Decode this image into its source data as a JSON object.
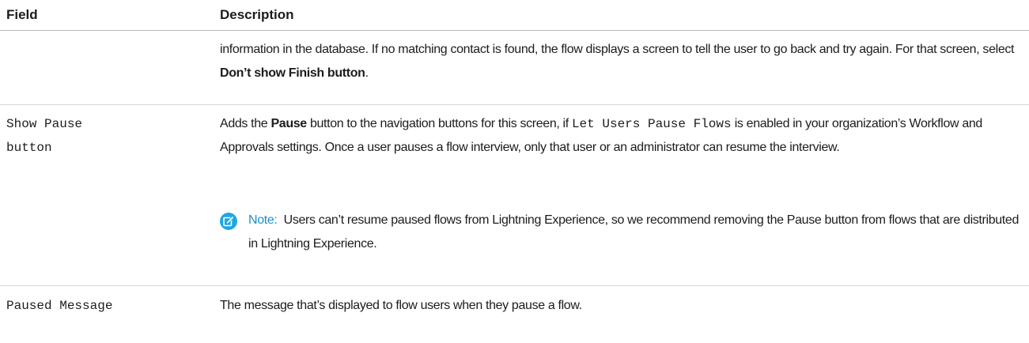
{
  "header": {
    "field": "Field",
    "description": "Description"
  },
  "rows": [
    {
      "field": "",
      "desc_before": "information in the database. If no matching contact is found, the flow displays a screen to tell the user to go back and try again. For that screen, select ",
      "desc_bold": "Don’t show Finish button",
      "desc_after": "."
    },
    {
      "field": "Show Pause\nbutton",
      "desc_part1": "Adds the ",
      "desc_bold": "Pause",
      "desc_part2": " button to the navigation buttons for this screen, if ",
      "desc_code": "Let Users Pause Flows",
      "desc_part3": " is enabled in your organization’s Workflow and Approvals settings. Once a user pauses a flow interview, only that user or an administrator can resume the interview.",
      "note": {
        "icon": "note-edit-icon",
        "label": "Note:",
        "text": "Users can’t resume paused flows from Lightning Experience, so we recommend removing the Pause button from flows that are distributed in Lightning Experience."
      }
    },
    {
      "field": "Paused Message",
      "description": "The message that’s displayed to flow users when they pause a flow."
    }
  ],
  "colors": {
    "note_accent": "#1a8fcf",
    "note_icon_bg": "#1ea8e0",
    "header_rule": "#b8b8b8",
    "row_rule": "#d6d6d6"
  }
}
